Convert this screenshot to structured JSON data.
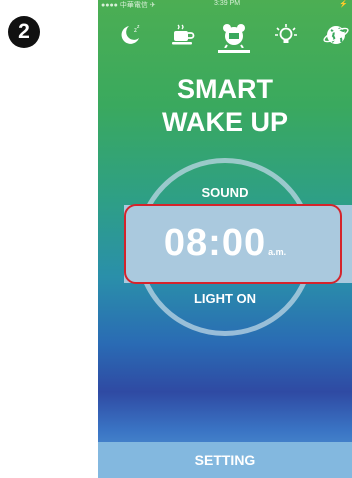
{
  "step": {
    "number": "2"
  },
  "status_bar": {
    "carrier": "●●●● 中華電信 ✈",
    "time": "3:39 PM",
    "battery": "⚡"
  },
  "icons": [
    {
      "name": "moon-sleep-icon",
      "active": false
    },
    {
      "name": "coffee-cup-icon",
      "active": false
    },
    {
      "name": "alarm-clock-icon",
      "active": true
    },
    {
      "name": "lightbulb-icon",
      "active": false
    },
    {
      "name": "globe-icon",
      "active": false
    }
  ],
  "title": {
    "line1": "SMART",
    "line2": "WAKE UP"
  },
  "dial": {
    "top_label": "SOUND",
    "time": "08:00",
    "ampm": "a.m.",
    "bottom_label": "LIGHT ON"
  },
  "footer": {
    "label": "SETTING"
  },
  "colors": {
    "highlight": "#d5232b",
    "band": "#aac9de",
    "footer": "#83b8df",
    "top_green": "#4cae53"
  }
}
